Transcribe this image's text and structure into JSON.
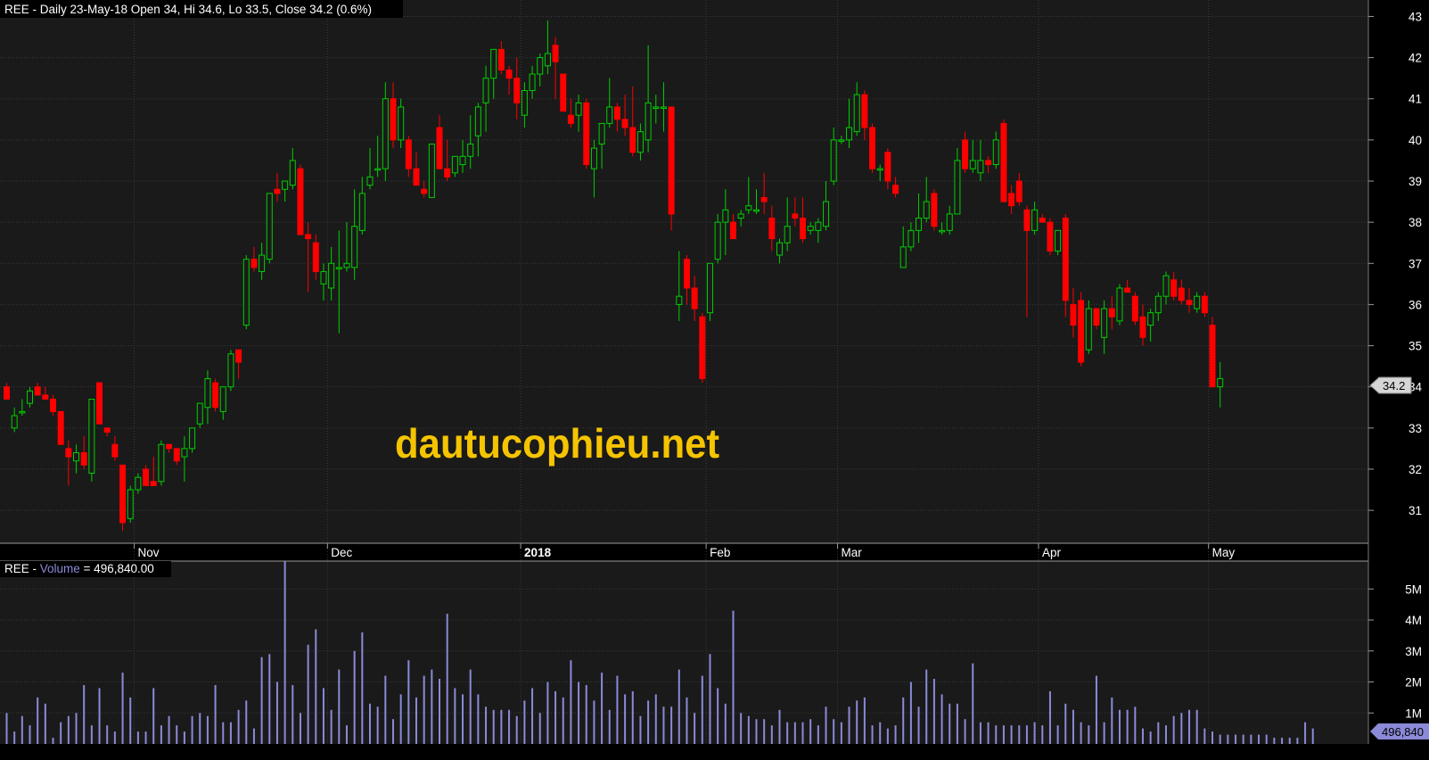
{
  "price_header": {
    "prefix": "REE - Daily 23-May-18 Open 34, Hi 34.6, Lo 33.5, Close 34.2 (0.6%)"
  },
  "volume_header": {
    "symbol": "REE - ",
    "series": "Volume",
    "equals": " = 496,840.00"
  },
  "watermark": "dautucophieu.net",
  "last_price_tag": "34.2",
  "last_volume_tag": "496,840",
  "colors": {
    "background": "#000000",
    "panel": "#1a1a1a",
    "up": "#00d000",
    "down": "#ff0000",
    "volume": "#8a8ad8",
    "watermark": "#f5c400",
    "grid": "#3a3a3a"
  },
  "chart_data": [
    {
      "type": "candlestick",
      "ylim": [
        30.2,
        43.4
      ],
      "ytick_values": [
        31,
        32,
        33,
        34,
        35,
        36,
        37,
        38,
        39,
        40,
        41,
        42,
        43
      ],
      "ytick_labels": [
        "31",
        "32",
        "33",
        "34",
        "35",
        "36",
        "37",
        "38",
        "39",
        "40",
        "41",
        "42",
        "43"
      ],
      "month_labels": [
        {
          "label": "Nov",
          "bar": 17,
          "bold": false
        },
        {
          "label": "Dec",
          "bar": 42,
          "bold": false
        },
        {
          "label": "2018",
          "bar": 67,
          "bold": true
        },
        {
          "label": "Feb",
          "bar": 91,
          "bold": false
        },
        {
          "label": "Mar",
          "bar": 108,
          "bold": false
        },
        {
          "label": "Apr",
          "bar": 134,
          "bold": false
        },
        {
          "label": "May",
          "bar": 156,
          "bold": false
        }
      ],
      "candles": [
        [
          34.0,
          34.1,
          33.7,
          33.7
        ],
        [
          33.0,
          33.5,
          32.9,
          33.3
        ],
        [
          33.4,
          33.7,
          33.3,
          33.4
        ],
        [
          33.6,
          34.0,
          33.5,
          33.9
        ],
        [
          34.0,
          34.1,
          33.8,
          33.8
        ],
        [
          33.8,
          34.0,
          33.7,
          33.7
        ],
        [
          33.7,
          33.8,
          33.3,
          33.4
        ],
        [
          33.4,
          33.4,
          32.6,
          32.6
        ],
        [
          32.5,
          32.7,
          31.6,
          32.3
        ],
        [
          32.2,
          32.6,
          31.9,
          32.4
        ],
        [
          32.4,
          32.8,
          32.0,
          32.1
        ],
        [
          31.9,
          33.7,
          31.7,
          33.7
        ],
        [
          34.1,
          34.1,
          33.1,
          33.1
        ],
        [
          33.0,
          33.0,
          32.8,
          32.9
        ],
        [
          32.6,
          32.8,
          32.2,
          32.3
        ],
        [
          32.1,
          32.1,
          30.5,
          30.7
        ],
        [
          30.8,
          31.6,
          30.7,
          31.5
        ],
        [
          31.5,
          31.9,
          31.4,
          31.8
        ],
        [
          32.0,
          32.1,
          31.6,
          31.6
        ],
        [
          31.7,
          32.3,
          31.6,
          31.6
        ],
        [
          31.7,
          32.7,
          31.6,
          32.6
        ],
        [
          32.6,
          32.6,
          32.4,
          32.5
        ],
        [
          32.5,
          32.5,
          32.1,
          32.2
        ],
        [
          32.3,
          32.8,
          31.7,
          32.5
        ],
        [
          32.5,
          33.0,
          32.4,
          33.0
        ],
        [
          33.1,
          33.6,
          33.0,
          33.6
        ],
        [
          33.5,
          34.4,
          33.1,
          34.2
        ],
        [
          34.1,
          34.2,
          33.4,
          33.5
        ],
        [
          33.4,
          34.0,
          33.2,
          34.0
        ],
        [
          34.0,
          34.9,
          33.9,
          34.8
        ],
        [
          34.9,
          34.9,
          34.2,
          34.6
        ],
        [
          35.5,
          37.2,
          35.4,
          37.1
        ],
        [
          37.1,
          37.4,
          36.8,
          36.9
        ],
        [
          36.8,
          37.5,
          36.6,
          37.2
        ],
        [
          37.1,
          38.7,
          37.0,
          38.7
        ],
        [
          38.8,
          39.2,
          38.5,
          38.7
        ],
        [
          38.8,
          39.0,
          38.5,
          39.0
        ],
        [
          38.9,
          39.8,
          38.8,
          39.5
        ],
        [
          39.3,
          39.4,
          37.8,
          37.7
        ],
        [
          37.7,
          38.0,
          36.3,
          37.6
        ],
        [
          37.5,
          37.7,
          36.6,
          36.8
        ],
        [
          36.5,
          37.0,
          36.1,
          36.8
        ],
        [
          36.4,
          37.4,
          36.1,
          37.0
        ],
        [
          36.9,
          37.8,
          35.3,
          36.9
        ],
        [
          36.9,
          38.0,
          36.8,
          37.0
        ],
        [
          36.9,
          38.8,
          36.6,
          37.9
        ],
        [
          37.8,
          39.1,
          37.7,
          38.7
        ],
        [
          38.9,
          39.8,
          38.8,
          39.1
        ],
        [
          39.3,
          40.1,
          39.1,
          39.3
        ],
        [
          39.3,
          41.4,
          39.0,
          41.0
        ],
        [
          41.0,
          41.4,
          39.8,
          40.0
        ],
        [
          40.0,
          41.0,
          39.8,
          40.8
        ],
        [
          40.0,
          40.1,
          39.1,
          39.3
        ],
        [
          39.3,
          39.7,
          39.0,
          38.9
        ],
        [
          38.8,
          39.0,
          38.6,
          38.7
        ],
        [
          38.6,
          39.9,
          38.6,
          39.9
        ],
        [
          40.3,
          40.6,
          39.3,
          39.3
        ],
        [
          39.3,
          40.0,
          39.0,
          39.1
        ],
        [
          39.2,
          39.4,
          39.1,
          39.6
        ],
        [
          39.4,
          40.0,
          39.2,
          39.6
        ],
        [
          39.6,
          40.6,
          39.3,
          39.9
        ],
        [
          40.1,
          40.9,
          39.6,
          40.8
        ],
        [
          40.9,
          41.8,
          40.2,
          41.5
        ],
        [
          41.5,
          42.2,
          41.0,
          42.2
        ],
        [
          42.2,
          42.4,
          41.6,
          41.7
        ],
        [
          41.7,
          41.8,
          41.1,
          41.5
        ],
        [
          41.5,
          42.0,
          40.5,
          40.9
        ],
        [
          40.6,
          41.4,
          40.3,
          41.2
        ],
        [
          41.2,
          41.8,
          41.0,
          41.6
        ],
        [
          41.6,
          42.1,
          41.3,
          42.0
        ],
        [
          41.8,
          42.9,
          41.6,
          42.1
        ],
        [
          42.3,
          42.5,
          41.0,
          41.9
        ],
        [
          41.6,
          41.6,
          41.0,
          40.7
        ],
        [
          40.6,
          41.0,
          40.3,
          40.4
        ],
        [
          40.6,
          41.1,
          40.2,
          40.9
        ],
        [
          40.9,
          41.0,
          39.3,
          39.4
        ],
        [
          39.3,
          40.0,
          38.6,
          39.8
        ],
        [
          39.9,
          40.4,
          39.3,
          40.4
        ],
        [
          40.4,
          41.5,
          40.3,
          40.8
        ],
        [
          40.8,
          40.9,
          40.2,
          40.5
        ],
        [
          40.5,
          41.1,
          40.1,
          40.3
        ],
        [
          40.3,
          41.3,
          39.6,
          39.7
        ],
        [
          39.7,
          40.4,
          39.5,
          40.2
        ],
        [
          40.0,
          42.3,
          39.7,
          40.9
        ],
        [
          40.8,
          41.1,
          40.4,
          40.8
        ],
        [
          40.8,
          41.4,
          40.2,
          40.8
        ],
        [
          40.8,
          40.8,
          37.8,
          38.2
        ],
        [
          36.0,
          37.3,
          35.6,
          36.2
        ],
        [
          37.1,
          37.2,
          36.0,
          36.4
        ],
        [
          36.4,
          36.7,
          35.6,
          35.9
        ],
        [
          35.7,
          35.8,
          34.1,
          34.2
        ],
        [
          35.8,
          37.0,
          35.6,
          37.0
        ],
        [
          37.1,
          38.2,
          37.0,
          38.0
        ],
        [
          38.0,
          38.8,
          37.2,
          38.3
        ],
        [
          38.0,
          38.2,
          37.6,
          37.6
        ],
        [
          38.1,
          38.3,
          37.9,
          38.2
        ],
        [
          38.3,
          39.1,
          38.2,
          38.4
        ],
        [
          38.3,
          38.8,
          38.2,
          38.3
        ],
        [
          38.6,
          39.2,
          38.2,
          38.5
        ],
        [
          38.1,
          38.4,
          37.3,
          37.6
        ],
        [
          37.2,
          37.6,
          37.0,
          37.5
        ],
        [
          37.5,
          38.6,
          37.3,
          37.9
        ],
        [
          38.2,
          38.6,
          37.9,
          38.1
        ],
        [
          38.1,
          38.6,
          37.5,
          37.6
        ],
        [
          37.8,
          38.0,
          37.7,
          37.9
        ],
        [
          37.8,
          38.1,
          37.5,
          38.0
        ],
        [
          37.9,
          39.0,
          37.8,
          38.5
        ],
        [
          39.0,
          40.3,
          38.9,
          40.0
        ],
        [
          40.0,
          40.1,
          39.9,
          40.0
        ],
        [
          40.0,
          41.0,
          39.8,
          40.3
        ],
        [
          40.2,
          41.4,
          40.1,
          41.1
        ],
        [
          41.1,
          41.2,
          40.0,
          40.3
        ],
        [
          40.3,
          40.4,
          39.2,
          39.3
        ],
        [
          39.3,
          39.4,
          39.0,
          39.3
        ],
        [
          39.7,
          39.8,
          38.8,
          39.0
        ],
        [
          38.9,
          39.1,
          38.6,
          38.7
        ],
        [
          36.9,
          37.9,
          36.9,
          37.4
        ],
        [
          37.4,
          38.0,
          37.3,
          37.8
        ],
        [
          37.8,
          38.7,
          37.5,
          38.1
        ],
        [
          38.1,
          39.1,
          38.0,
          38.5
        ],
        [
          38.7,
          38.8,
          37.8,
          37.9
        ],
        [
          37.8,
          38.0,
          37.7,
          37.8
        ],
        [
          37.8,
          38.4,
          37.7,
          38.2
        ],
        [
          38.2,
          39.8,
          38.2,
          39.5
        ],
        [
          40.0,
          40.2,
          39.2,
          39.3
        ],
        [
          39.3,
          40.0,
          39.2,
          39.5
        ],
        [
          39.2,
          40.0,
          39.0,
          39.5
        ],
        [
          39.5,
          39.6,
          39.2,
          39.4
        ],
        [
          39.4,
          40.2,
          39.3,
          40.0
        ],
        [
          40.4,
          40.5,
          38.5,
          38.5
        ],
        [
          38.7,
          38.9,
          38.2,
          38.4
        ],
        [
          39.0,
          39.2,
          38.4,
          38.5
        ],
        [
          38.3,
          38.4,
          35.7,
          37.8
        ],
        [
          37.8,
          38.5,
          37.7,
          38.3
        ],
        [
          38.1,
          38.2,
          38.0,
          38.0
        ],
        [
          38.0,
          38.1,
          37.2,
          37.3
        ],
        [
          37.3,
          37.5,
          37.2,
          37.8
        ],
        [
          38.1,
          38.2,
          35.7,
          36.1
        ],
        [
          36.0,
          36.4,
          35.2,
          35.5
        ],
        [
          36.1,
          36.3,
          34.5,
          34.6
        ],
        [
          34.9,
          36.1,
          34.8,
          35.9
        ],
        [
          35.9,
          35.9,
          35.4,
          35.5
        ],
        [
          35.2,
          36.1,
          34.8,
          35.9
        ],
        [
          35.9,
          36.2,
          35.4,
          35.7
        ],
        [
          35.6,
          36.5,
          35.5,
          36.4
        ],
        [
          36.4,
          36.6,
          36.3,
          36.3
        ],
        [
          36.2,
          36.3,
          35.5,
          35.6
        ],
        [
          35.7,
          36.0,
          35.0,
          35.2
        ],
        [
          35.5,
          35.9,
          35.1,
          35.8
        ],
        [
          35.8,
          36.3,
          35.6,
          36.2
        ],
        [
          36.2,
          36.8,
          36.0,
          36.7
        ],
        [
          36.6,
          36.8,
          36.1,
          36.2
        ],
        [
          36.4,
          36.6,
          36.0,
          36.1
        ],
        [
          36.1,
          36.4,
          35.8,
          36.0
        ],
        [
          35.9,
          36.3,
          35.8,
          36.2
        ],
        [
          36.2,
          36.3,
          35.7,
          35.8
        ],
        [
          35.5,
          35.7,
          34.0,
          34.0
        ],
        [
          34.0,
          34.6,
          33.5,
          34.2
        ]
      ]
    },
    {
      "type": "bar",
      "ylim": [
        0,
        5.9
      ],
      "ytick_values": [
        1,
        2,
        3,
        4,
        5
      ],
      "ytick_labels": [
        "1M",
        "2M",
        "3M",
        "4M",
        "5M"
      ],
      "values": [
        1.0,
        0.4,
        0.9,
        0.6,
        1.5,
        1.3,
        0.2,
        0.7,
        0.9,
        1.0,
        1.9,
        0.6,
        1.8,
        0.6,
        0.4,
        2.3,
        1.5,
        0.4,
        0.4,
        1.8,
        0.6,
        0.9,
        0.6,
        0.4,
        0.9,
        1.0,
        0.9,
        1.9,
        0.7,
        0.7,
        1.1,
        1.4,
        0.5,
        2.8,
        2.9,
        2.0,
        5.9,
        1.9,
        1.0,
        3.2,
        3.7,
        1.8,
        1.1,
        2.4,
        0.6,
        3.0,
        3.6,
        1.3,
        1.2,
        2.2,
        0.8,
        1.6,
        2.7,
        1.5,
        2.2,
        2.4,
        2.1,
        4.2,
        1.8,
        1.6,
        2.4,
        1.6,
        1.2,
        1.1,
        1.1,
        1.1,
        0.9,
        1.4,
        1.8,
        1.0,
        2.0,
        1.7,
        1.5,
        2.7,
        2.0,
        1.9,
        1.4,
        2.3,
        1.1,
        2.2,
        1.6,
        1.7,
        0.9,
        1.4,
        1.6,
        1.2,
        1.2,
        2.4,
        1.5,
        1.0,
        2.2,
        2.9,
        1.8,
        1.3,
        4.3,
        1.0,
        0.9,
        0.8,
        0.8,
        0.6,
        1.1,
        0.7,
        0.7,
        0.7,
        0.8,
        0.6,
        1.2,
        0.8,
        0.7,
        1.2,
        1.4,
        1.5,
        0.6,
        0.7,
        0.5,
        0.6,
        1.5,
        2.0,
        1.2,
        2.4,
        2.1,
        1.6,
        1.3,
        1.3,
        0.8,
        2.6,
        0.7,
        0.7,
        0.6,
        0.6,
        0.6,
        0.6,
        0.6,
        0.7,
        0.6,
        1.7,
        0.6,
        1.3,
        1.1,
        0.7,
        0.6,
        2.2,
        0.7,
        1.5,
        1.1,
        1.1,
        1.2,
        0.5,
        0.4,
        0.7,
        0.6,
        0.9,
        1.0,
        1.1,
        1.1,
        0.5,
        0.4,
        0.3,
        0.3,
        0.3,
        0.3,
        0.3,
        0.3,
        0.3,
        0.2,
        0.2,
        0.2,
        0.2,
        0.7,
        0.5
      ]
    }
  ]
}
